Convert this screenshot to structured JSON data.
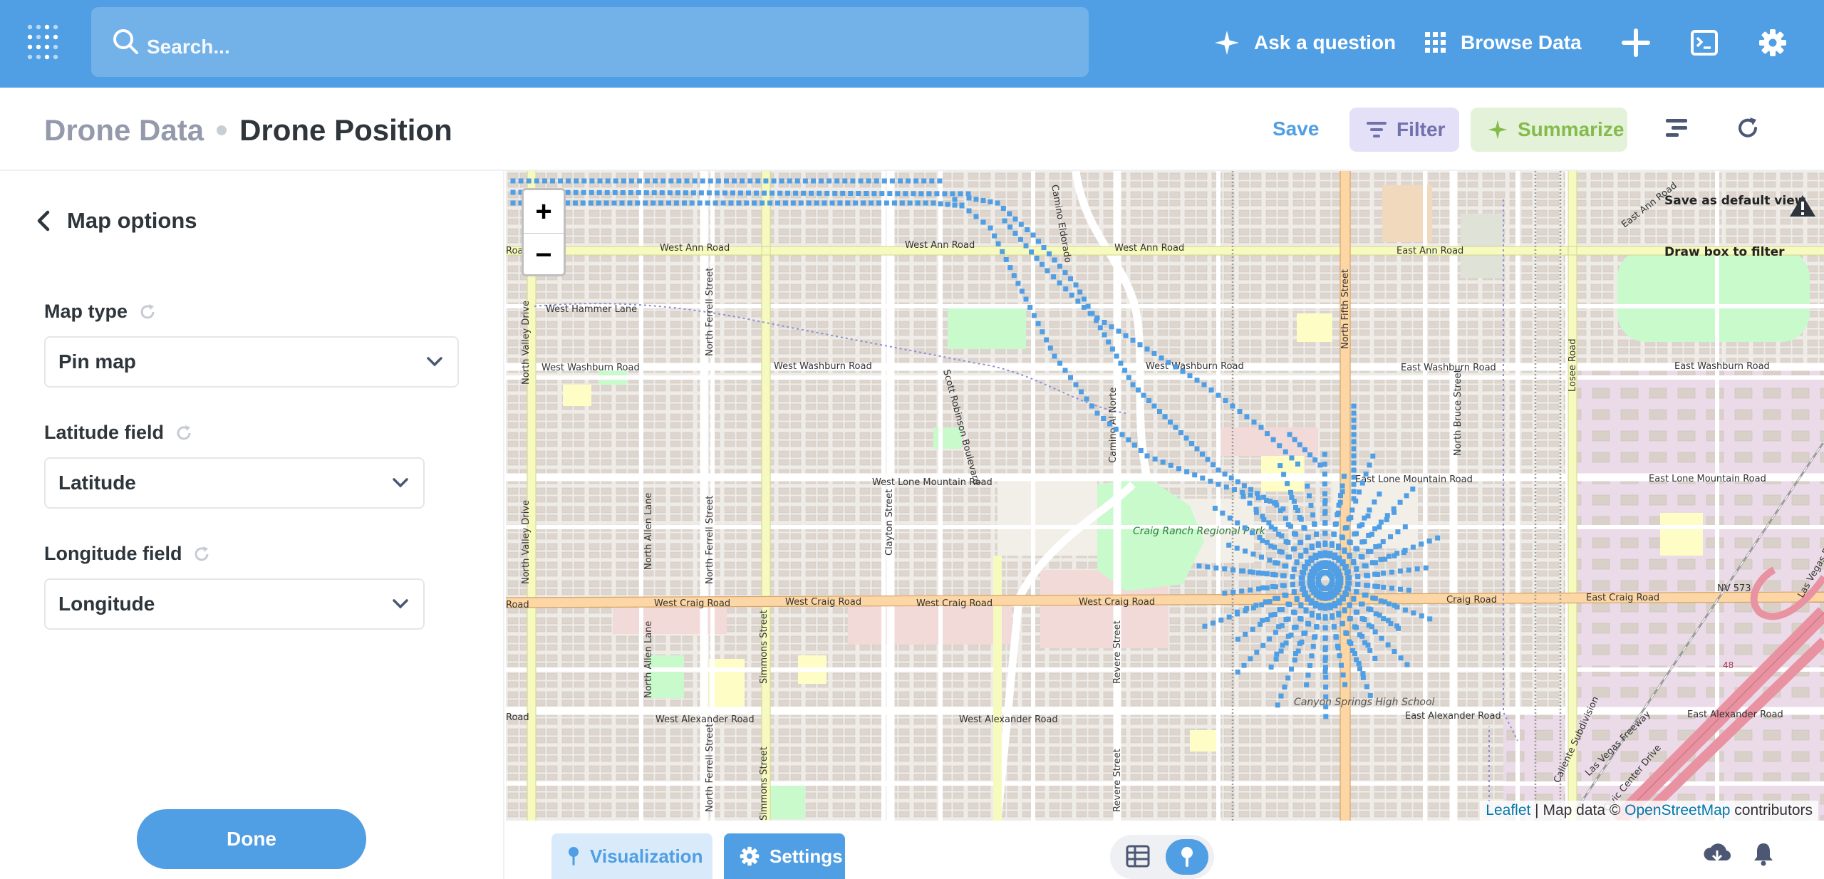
{
  "nav": {
    "search_placeholder": "Search...",
    "ask_label": "Ask a question",
    "browse_label": "Browse Data"
  },
  "header": {
    "collection": "Drone Data",
    "title": "Drone Position",
    "save_label": "Save",
    "filter_label": "Filter",
    "summarize_label": "Summarize"
  },
  "sidebar": {
    "title": "Map options",
    "map_type_label": "Map type",
    "map_type_value": "Pin map",
    "latitude_label": "Latitude field",
    "latitude_value": "Latitude",
    "longitude_label": "Longitude field",
    "longitude_value": "Longitude",
    "done_label": "Done"
  },
  "map": {
    "zoom_in": "+",
    "zoom_out": "−",
    "save_default_view": "Save as default view",
    "draw_box": "Draw box to filter",
    "attribution_leaflet": "Leaflet",
    "attribution_mid": " | Map data © ",
    "attribution_osm": "OpenStreetMap",
    "attribution_end": " contributors",
    "pin_color": "#509ee3",
    "streets": [
      "West Ann Road",
      "West Ann Road",
      "West Ann Road",
      "East Ann Road",
      "East Ann Road",
      "West Hammer Lane",
      "West Washburn Road",
      "West Washburn Road",
      "West Washburn Road",
      "East Washburn Road",
      "East Washburn Road",
      "West Lone Mountain Road",
      "East Lone Mountain Road",
      "East Lone Mountain Road",
      "West Craig Road",
      "West Craig Road",
      "West Craig Road",
      "West Craig Road",
      "Craig Road",
      "East Craig Road",
      "NV 573",
      "West Alexander Road",
      "West Alexander Road",
      "East Alexander Road",
      "East Alexander Road",
      "North Valley Drive",
      "North Valley Drive",
      "North Ferrell Street",
      "North Ferrell Street",
      "North Ferrell Street",
      "North Allen Lane",
      "North Allen Lane",
      "Simmons Street",
      "Simmons Street",
      "Clayton Street",
      "Scott Robinson Boulevard",
      "Camino Eldorado",
      "Camino Al Norte",
      "Revere Street",
      "Revere Street",
      "North Fifth Street",
      "North Bruce Street",
      "Losee Road",
      "Las Vegas Freeway",
      "Civic Center Drive",
      "Caliente Subdivision",
      "Las Vegas Freeway",
      "Road",
      "Road",
      "Road"
    ],
    "park_label": "Craig Ranch Regional Park",
    "school_label": "Canyon Springs High School",
    "highway_shield": "48"
  },
  "footer": {
    "visualization_label": "Visualization",
    "settings_label": "Settings"
  }
}
